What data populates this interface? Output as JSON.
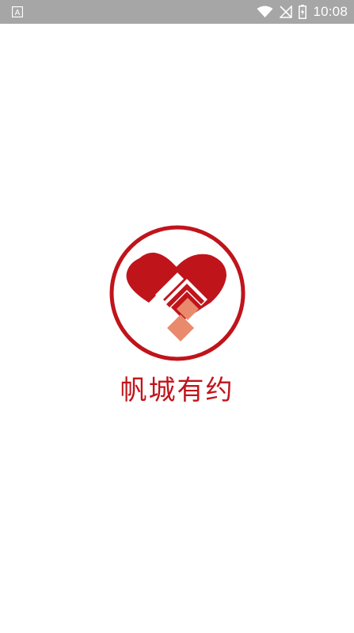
{
  "status_bar": {
    "time": "10:08",
    "left_icon": "a-notification-icon",
    "icons": [
      "wifi-icon",
      "no-signal-icon",
      "battery-charging-icon"
    ]
  },
  "splash": {
    "app_name": "帆城有约",
    "logo": "heart-handshake-logo",
    "brand_color": "#c0141b",
    "accent_color": "#e98a6c"
  }
}
